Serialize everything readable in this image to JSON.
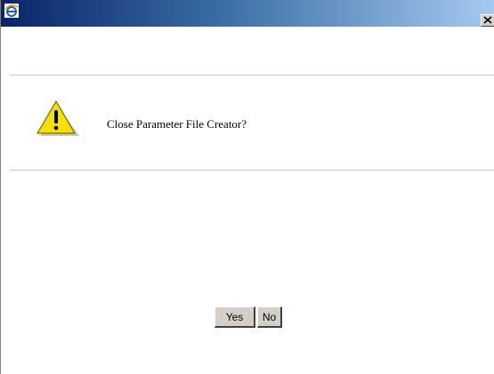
{
  "titlebar": {
    "app_icon": "internet-explorer-icon",
    "close_icon": "close-icon"
  },
  "dialog": {
    "icon": "warning-icon",
    "message": "Close Parameter File Creator?",
    "buttons": {
      "yes_label": "Yes",
      "no_label": "No"
    }
  },
  "colors": {
    "titlebar_start": "#0a246a",
    "titlebar_end": "#a6caf0",
    "button_face": "#d4d0c8",
    "warning_yellow": "#f5e000",
    "rule": "#c8c8c8"
  }
}
